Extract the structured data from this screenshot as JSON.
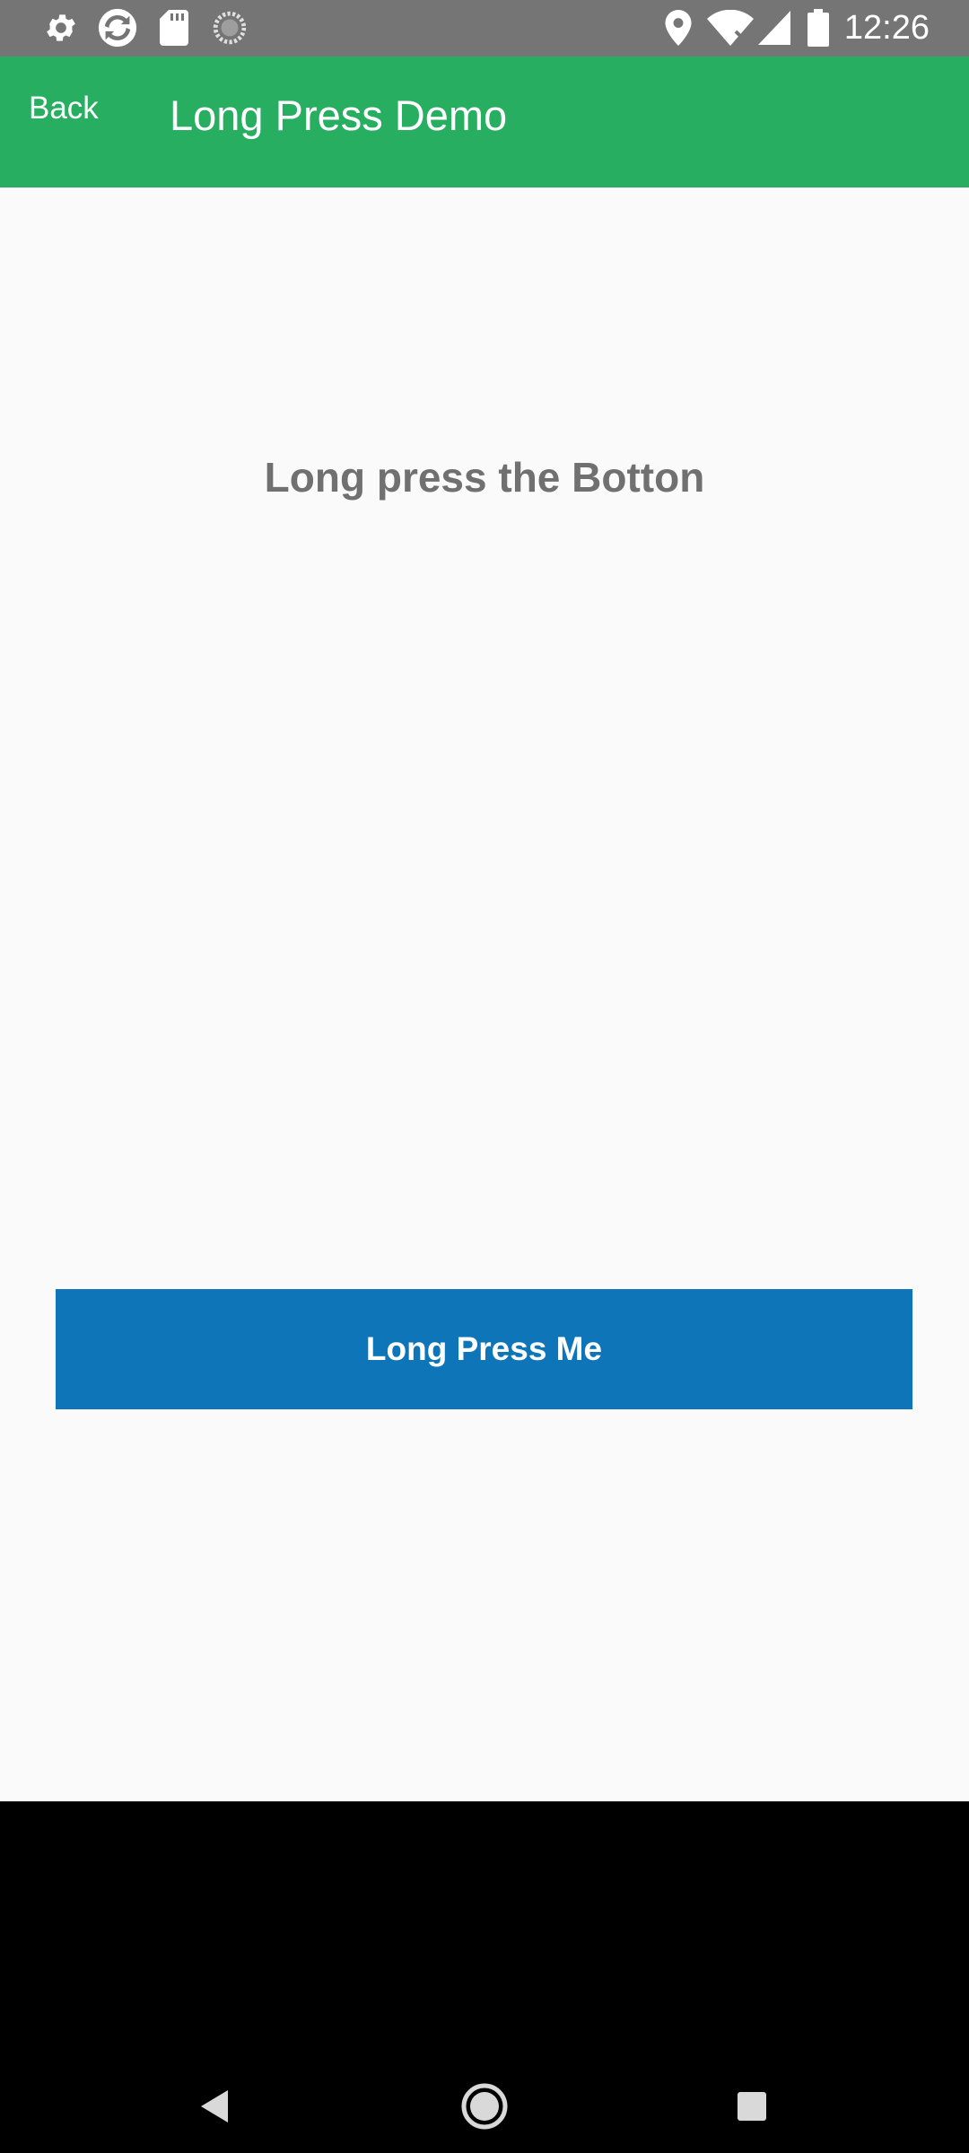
{
  "status_bar": {
    "time": "12:26",
    "left_icons": [
      "settings-icon",
      "sync-icon",
      "sd-card-icon",
      "loading-icon"
    ],
    "right_icons": [
      "location-icon",
      "wifi-off-icon",
      "signal-icon",
      "battery-icon"
    ],
    "background": "#757575"
  },
  "app_bar": {
    "back_label": "Back",
    "title": "Long Press Demo",
    "background": "#27ae60"
  },
  "main": {
    "instruction": "Long press the Botton",
    "button_label": "Long Press Me",
    "button_color": "#0e76b8",
    "background": "#fafafa"
  },
  "nav_bar": {
    "buttons": [
      "back-nav-icon",
      "home-nav-icon",
      "recents-nav-icon"
    ]
  }
}
